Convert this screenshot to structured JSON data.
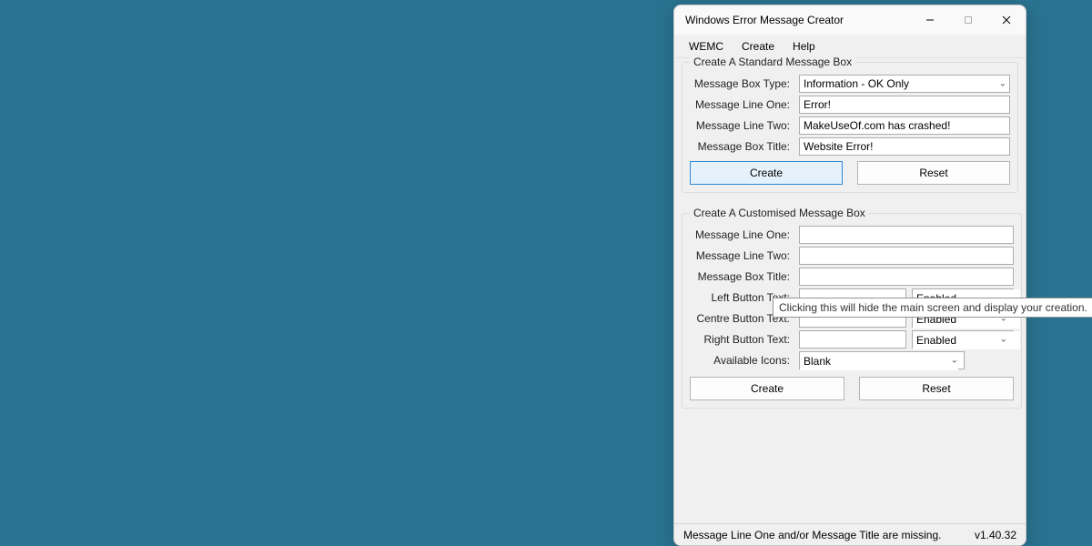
{
  "window": {
    "title": "Windows Error Message Creator"
  },
  "menu": {
    "wemc": "WEMC",
    "create": "Create",
    "help": "Help"
  },
  "std": {
    "legend": "Create A Standard Message Box",
    "type_label": "Message Box Type:",
    "type_value": "Information - OK Only",
    "line1_label": "Message Line One:",
    "line1_value": "Error!",
    "line2_label": "Message Line Two:",
    "line2_value": "MakeUseOf.com has crashed!",
    "title_label": "Message Box Title:",
    "title_value": "Website Error!",
    "create_btn": "Create",
    "reset_btn": "Reset"
  },
  "tooltip": "Clicking this will hide the main screen and display your creation.",
  "cus": {
    "legend": "Create A Customised Message Box",
    "line1_label": "Message Line One:",
    "line1_value": "",
    "line2_label": "Message Line Two:",
    "line2_value": "",
    "title_label": "Message Box Title:",
    "title_value": "",
    "left_label": "Left Button Text:",
    "left_value": "",
    "left_state": "Enabled",
    "centre_label": "Centre Button Text:",
    "centre_value": "",
    "centre_state": "Enabled",
    "right_label": "Right Button Text:",
    "right_value": "",
    "right_state": "Enabled",
    "icons_label": "Available Icons:",
    "icons_value": "Blank",
    "create_btn": "Create",
    "reset_btn": "Reset"
  },
  "status": {
    "msg": "Message Line One and/or Message Title are missing.",
    "ver": "v1.40.32"
  }
}
